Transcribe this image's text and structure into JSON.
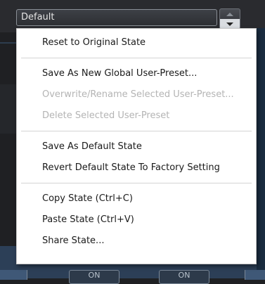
{
  "preset": {
    "selected": "Default"
  },
  "menu": {
    "group1": [
      {
        "label": "Reset to Original State",
        "enabled": true
      }
    ],
    "group2": [
      {
        "label": "Save As New Global User-Preset...",
        "enabled": true
      },
      {
        "label": "Overwrite/Rename Selected User-Preset...",
        "enabled": false
      },
      {
        "label": "Delete Selected User-Preset",
        "enabled": false
      }
    ],
    "group3": [
      {
        "label": "Save As Default State",
        "enabled": true
      },
      {
        "label": "Revert Default State To Factory Setting",
        "enabled": true
      }
    ],
    "group4": [
      {
        "label": "Copy State (Ctrl+C)",
        "enabled": true
      },
      {
        "label": "Paste State (Ctrl+V)",
        "enabled": true
      },
      {
        "label": "Share State...",
        "enabled": true
      }
    ]
  },
  "background": {
    "button1_label": "ON",
    "button2_label": "ON"
  },
  "colors": {
    "menu_bg": "#ffffff",
    "menu_text": "#1a1a1a",
    "disabled_text": "#b4b4b4",
    "app_bg": "#1f2023",
    "accent_blue": "#3f5877"
  },
  "icons": {
    "stepper_up": "chevron-up-icon",
    "stepper_down": "chevron-down-icon"
  }
}
